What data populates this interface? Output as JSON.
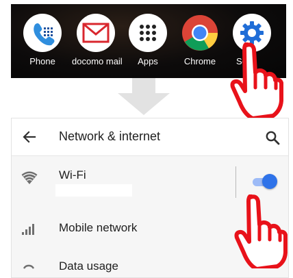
{
  "dock": {
    "apps": [
      {
        "label": "Phone",
        "icon": "phone-icon"
      },
      {
        "label": "docomo mail",
        "icon": "mail-icon"
      },
      {
        "label": "Apps",
        "icon": "apps-grid-icon"
      },
      {
        "label": "Chrome",
        "icon": "chrome-icon"
      },
      {
        "label": "Se",
        "icon": "settings-gear-icon"
      }
    ]
  },
  "settings": {
    "title": "Network & internet",
    "items": [
      {
        "label": "Wi-Fi",
        "icon": "wifi-icon",
        "toggle": true
      },
      {
        "label": "Mobile network",
        "icon": "signal-icon"
      },
      {
        "label": "Data usage",
        "icon": "data-usage-icon"
      }
    ]
  },
  "colors": {
    "accent": "#2f73e9",
    "pointer_red": "#e8121a"
  }
}
